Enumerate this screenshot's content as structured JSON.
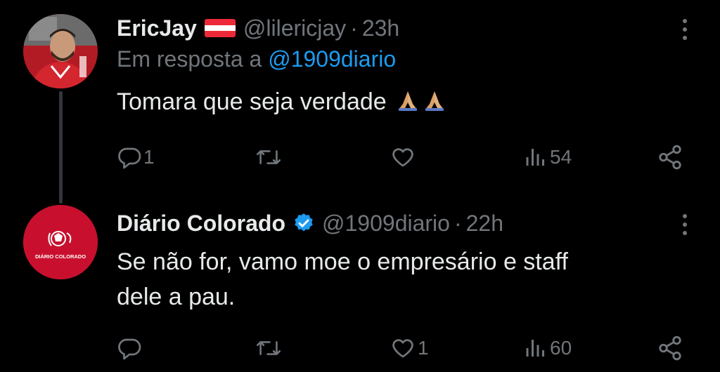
{
  "tweets": [
    {
      "display_name": "EricJay",
      "flag_icon": "austria-flag-icon",
      "handle": "@lilericjay",
      "separator": "·",
      "time": "23h",
      "reply_prefix": "Em resposta a",
      "reply_to": "@1909diario",
      "text": "Tomara que seja verdade",
      "emoji": "🙏🙏",
      "actions": {
        "reply_count": "1",
        "retweet_count": "",
        "like_count": "",
        "views_count": "54"
      }
    },
    {
      "display_name": "Diário Colorado",
      "verified_icon": "verified-badge-icon",
      "handle": "@1909diario",
      "separator": "·",
      "time": "22h",
      "avatar_text": "DIÁRIO COLORADO",
      "text_line1": "Se não for, vamo moe o empresário e staff",
      "text_line2": "dele a pau.",
      "actions": {
        "reply_count": "",
        "retweet_count": "",
        "like_count": "1",
        "views_count": "60"
      }
    }
  ],
  "colors": {
    "background": "#000000",
    "text": "#e7e9ea",
    "muted": "#71767b",
    "link": "#1d9bf0",
    "verified": "#1d9bf0",
    "brand_red": "#c8102e",
    "thread_line": "#333639"
  }
}
